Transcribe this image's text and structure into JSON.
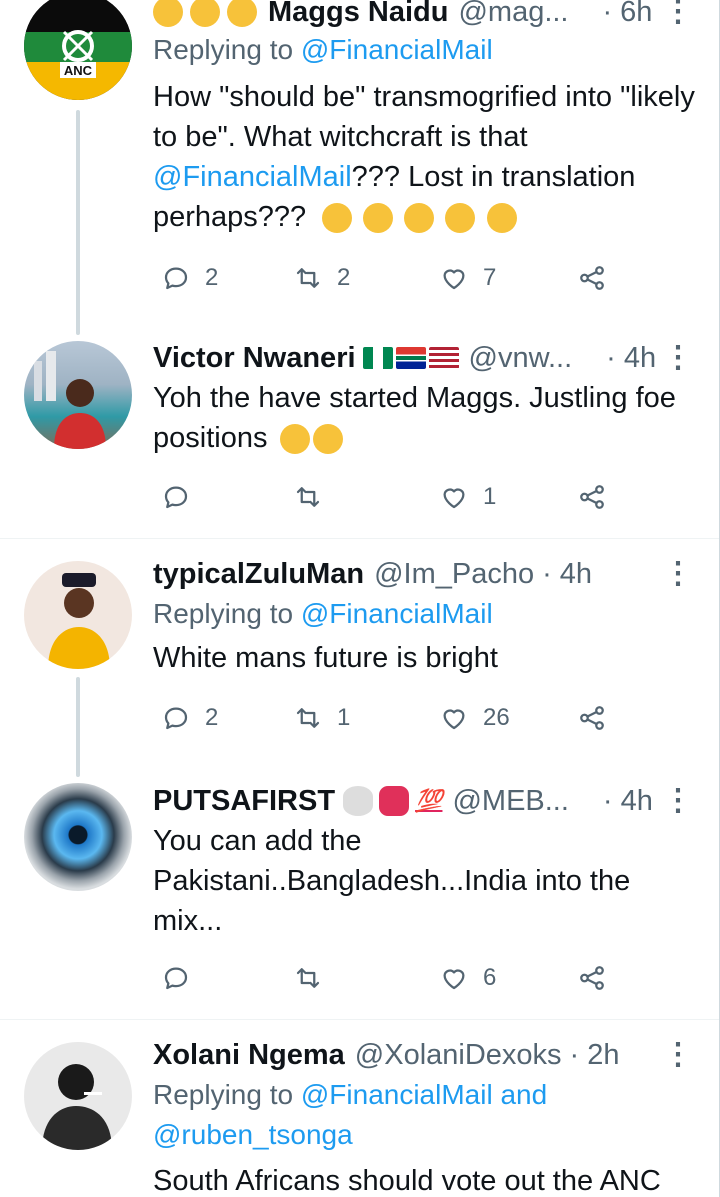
{
  "tweets": [
    {
      "name": "Maggs Naidu",
      "handle": "@mag...",
      "time": "6h",
      "replying_label": "Replying to",
      "replying_to": "@FinancialMail",
      "body_prefix": "How \"should be\" transmogrified into \"likely to be\". What witchcraft is that ",
      "body_mention": "@FinancialMail",
      "body_suffix": "??? Lost in translation perhaps???",
      "replies": "2",
      "retweets": "2",
      "likes": "7",
      "avatar_label": "ANC"
    },
    {
      "name": "Victor Nwaneri",
      "handle": "@vnw...",
      "time": "4h",
      "body": "Yoh the have started Maggs. Justling foe positions",
      "replies": "",
      "retweets": "",
      "likes": "1"
    },
    {
      "name": "typicalZuluMan",
      "handle": "@Im_Pacho",
      "time": "4h",
      "replying_label": "Replying to",
      "replying_to": "@FinancialMail",
      "body": "White mans future is bright",
      "replies": "2",
      "retweets": "1",
      "likes": "26"
    },
    {
      "name": "PUTSAFIRST",
      "handle": "@MEB...",
      "time": "4h",
      "body": "You can add the Pakistani..Bangladesh...India into the mix...",
      "replies": "",
      "retweets": "",
      "likes": "6",
      "emoji_text": "💯"
    },
    {
      "name": "Xolani Ngema",
      "handle": "@XolaniDexoks",
      "time": "2h",
      "replying_label": "Replying to",
      "replying_to": "@FinancialMail",
      "replying_and": "and",
      "replying_to_2": "@ruben_tsonga",
      "body": "South Africans should vote out the ANC"
    }
  ],
  "dot": "·",
  "colors": {
    "link": "#1d9bf0",
    "secondary": "#536471",
    "divider": "#eff3f4"
  }
}
